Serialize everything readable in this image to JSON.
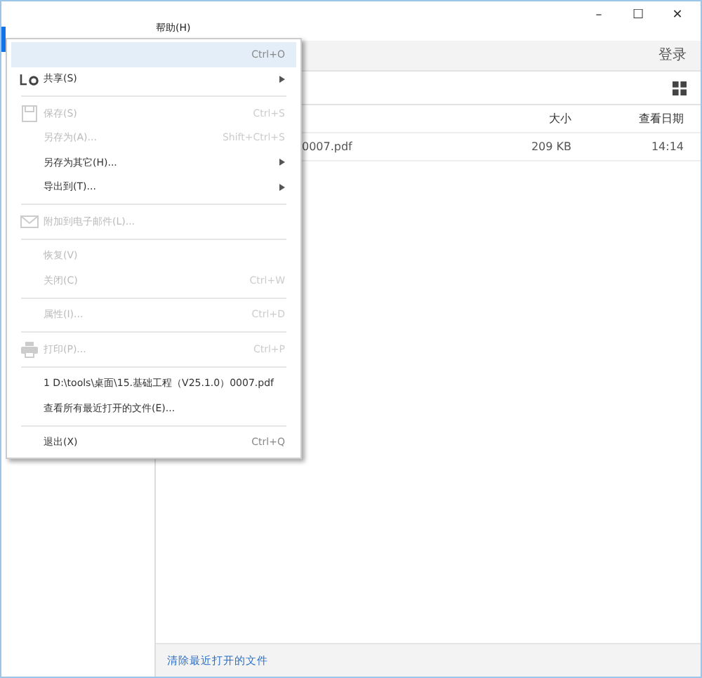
{
  "window": {
    "controls": [
      "–",
      "☐",
      "✕"
    ]
  },
  "menu_bar": [
    {
      "label": "帮助(H)"
    }
  ],
  "toolbar": {
    "login": "登录"
  },
  "table": {
    "columns": [
      "大小",
      "查看日期"
    ],
    "rows": [
      {
        "name": "0007.pdf",
        "size": "209 KB",
        "date": "14:14"
      }
    ]
  },
  "footer": {
    "link": "清除最近打开的文件"
  },
  "menu": [
    {
      "kind": "item",
      "shortcut": "Ctrl+O",
      "disabled": false,
      "selected": true,
      "submenu": false
    },
    {
      "kind": "share-item",
      "label": "共享(S)",
      "disabled": false,
      "selected": false,
      "submenu": true
    },
    {
      "kind": "separator"
    },
    {
      "kind": "save-item",
      "label": "保存(S)",
      "shortcut": "Ctrl+S",
      "disabled": true,
      "selected": false,
      "submenu": false
    },
    {
      "kind": "item",
      "label": "另存为(A)...",
      "shortcut": "Shift+Ctrl+S",
      "disabled": true,
      "selected": false,
      "submenu": false
    },
    {
      "kind": "item",
      "label": "另存为其它(H)...",
      "disabled": false,
      "selected": false,
      "submenu": true
    },
    {
      "kind": "item",
      "label": "导出到(T)...",
      "disabled": false,
      "selected": false,
      "submenu": true
    },
    {
      "kind": "separator"
    },
    {
      "kind": "mail-item",
      "label": "附加到电子邮件(L)...",
      "disabled": true,
      "selected": false,
      "submenu": false
    },
    {
      "kind": "separator"
    },
    {
      "kind": "item",
      "label": "恢复(V)",
      "disabled": true,
      "selected": false,
      "submenu": false
    },
    {
      "kind": "item",
      "label": "关闭(C)",
      "shortcut": "Ctrl+W",
      "disabled": true,
      "selected": false,
      "submenu": false
    },
    {
      "kind": "separator"
    },
    {
      "kind": "item",
      "label": "属性(I)...",
      "shortcut": "Ctrl+D",
      "disabled": true,
      "selected": false,
      "submenu": false
    },
    {
      "kind": "separator"
    },
    {
      "kind": "print-item",
      "label": "打印(P)...",
      "shortcut": "Ctrl+P",
      "disabled": true,
      "selected": false,
      "submenu": false
    },
    {
      "kind": "separator"
    },
    {
      "kind": "item",
      "label": "1 D:\\tools\\桌面\\15.基础工程（V25.1.0）0007.pdf",
      "disabled": false,
      "selected": false,
      "submenu": false
    },
    {
      "kind": "item",
      "label": "查看所有最近打开的文件(E)...",
      "disabled": false,
      "selected": false,
      "submenu": false
    },
    {
      "kind": "separator"
    },
    {
      "kind": "item",
      "label": "退出(X)",
      "shortcut": "Ctrl+Q",
      "disabled": false,
      "selected": false,
      "submenu": false
    }
  ]
}
